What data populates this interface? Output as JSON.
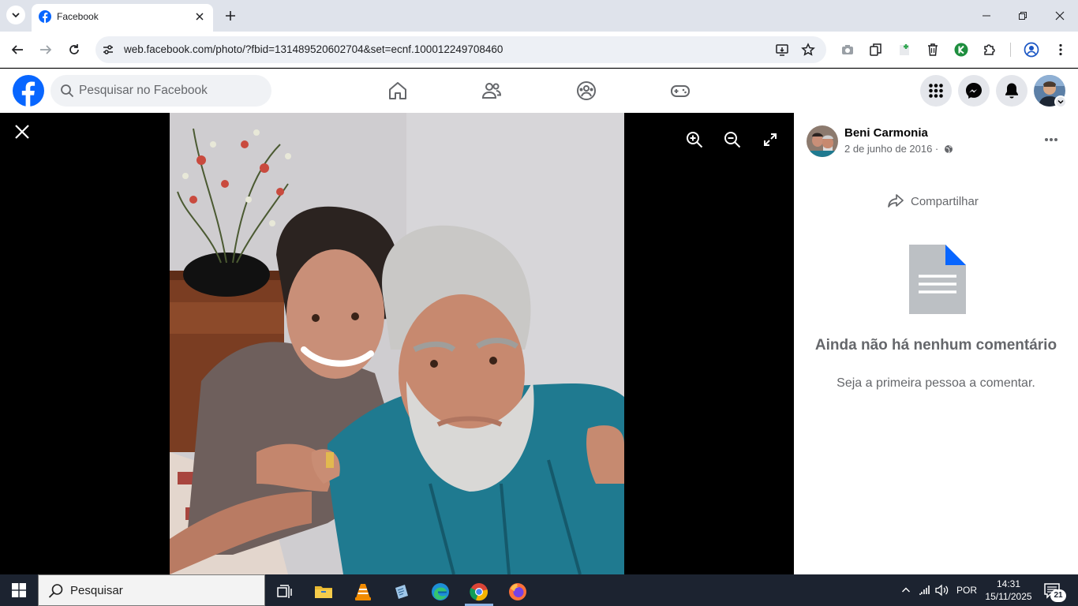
{
  "browser": {
    "tab_title": "Facebook",
    "url": "web.facebook.com/photo/?fbid=131489520602704&set=ecnf.100012249708460"
  },
  "facebook": {
    "search_placeholder": "Pesquisar no Facebook",
    "brand_color": "#0866ff"
  },
  "post": {
    "author": "Beni Carmonia",
    "date": "2 de junho de 2016 ·",
    "share_label": "Compartilhar",
    "empty_title": "Ainda não há nenhum comentário",
    "empty_subtitle": "Seja a primeira pessoa a comentar."
  },
  "taskbar": {
    "search_label": "Pesquisar",
    "language": "POR",
    "time": "14:31",
    "date": "15/11/2025",
    "notification_count": "21"
  }
}
